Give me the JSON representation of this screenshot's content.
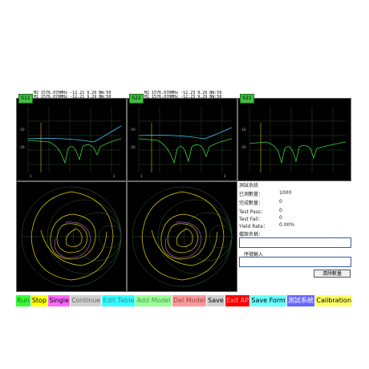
{
  "panels": {
    "s11": {
      "tag": "S11",
      "marker2": "M2 1576.070MHz -12.21 9.29 BW:50",
      "marker1": "M1 1576.070MHz -12.21 9.29 BW:50"
    },
    "s22": {
      "tag": "S22",
      "marker2": "M2 1576.070MHz -12.23 9.29 BW:50",
      "marker1": "M1 1576.070MHz -12.23 9.29 BW:50"
    },
    "s21": {
      "tag": "S21"
    }
  },
  "side_panel": {
    "title": "測試系統",
    "total_label": "已測數量：",
    "total_value": "1000",
    "done_label": "完成數量：",
    "done_value": "0",
    "pass_label": "Test Pass：",
    "pass_value": "0",
    "fail_label": "Test Fail：",
    "fail_value": "0",
    "yield_label": "Yield Rate：",
    "yield_value": "0.00%",
    "file_label": "檔案名稱：",
    "file_value": "",
    "serial_label": "序號輸入",
    "serial_value": "",
    "clear_button": "清除數量"
  },
  "toolbar": [
    {
      "label": "Run",
      "bg": "#33ff33",
      "fg": "#1a7a1a"
    },
    {
      "label": "Stop",
      "bg": "#ffff00",
      "fg": "#000000"
    },
    {
      "label": "Single",
      "bg": "#ff66ff",
      "fg": "#000000"
    },
    {
      "label": "Continue",
      "bg": "#d0d0d0",
      "fg": "#666666"
    },
    {
      "label": "Edit Table",
      "bg": "#33ffff",
      "fg": "#2a8a8a"
    },
    {
      "label": "Add Model",
      "bg": "#99ff99",
      "fg": "#4a9a4a"
    },
    {
      "label": "Del Model",
      "bg": "#ff9999",
      "fg": "#8a4a4a"
    },
    {
      "label": "Save",
      "bg": "#d0d0d0",
      "fg": "#000000"
    },
    {
      "label": "Exit AP",
      "bg": "#ff0000",
      "fg": "#ffaaaa"
    },
    {
      "label": "Save Form",
      "bg": "#66ffff",
      "fg": "#000000"
    },
    {
      "label": "測試系統",
      "bg": "#6666ff",
      "fg": "#ffffff"
    },
    {
      "label": "Calibration",
      "bg": "#ffff66",
      "fg": "#000000"
    }
  ]
}
